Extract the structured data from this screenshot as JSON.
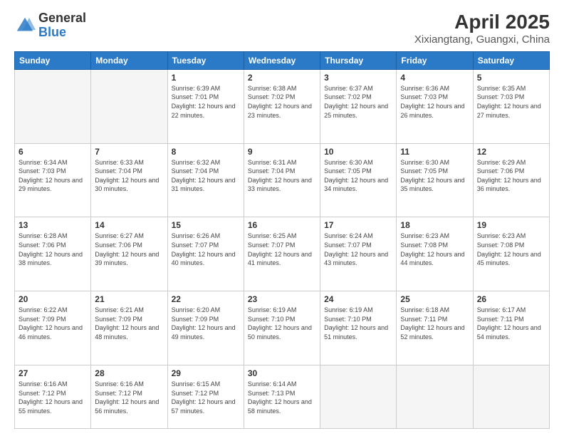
{
  "header": {
    "logo_general": "General",
    "logo_blue": "Blue",
    "title": "April 2025",
    "subtitle": "Xixiangtang, Guangxi, China"
  },
  "days_of_week": [
    "Sunday",
    "Monday",
    "Tuesday",
    "Wednesday",
    "Thursday",
    "Friday",
    "Saturday"
  ],
  "weeks": [
    [
      {
        "day": "",
        "empty": true
      },
      {
        "day": "",
        "empty": true
      },
      {
        "day": "1",
        "sunrise": "6:39 AM",
        "sunset": "7:01 PM",
        "daylight": "12 hours and 22 minutes."
      },
      {
        "day": "2",
        "sunrise": "6:38 AM",
        "sunset": "7:02 PM",
        "daylight": "12 hours and 23 minutes."
      },
      {
        "day": "3",
        "sunrise": "6:37 AM",
        "sunset": "7:02 PM",
        "daylight": "12 hours and 25 minutes."
      },
      {
        "day": "4",
        "sunrise": "6:36 AM",
        "sunset": "7:03 PM",
        "daylight": "12 hours and 26 minutes."
      },
      {
        "day": "5",
        "sunrise": "6:35 AM",
        "sunset": "7:03 PM",
        "daylight": "12 hours and 27 minutes."
      }
    ],
    [
      {
        "day": "6",
        "sunrise": "6:34 AM",
        "sunset": "7:03 PM",
        "daylight": "12 hours and 29 minutes."
      },
      {
        "day": "7",
        "sunrise": "6:33 AM",
        "sunset": "7:04 PM",
        "daylight": "12 hours and 30 minutes."
      },
      {
        "day": "8",
        "sunrise": "6:32 AM",
        "sunset": "7:04 PM",
        "daylight": "12 hours and 31 minutes."
      },
      {
        "day": "9",
        "sunrise": "6:31 AM",
        "sunset": "7:04 PM",
        "daylight": "12 hours and 33 minutes."
      },
      {
        "day": "10",
        "sunrise": "6:30 AM",
        "sunset": "7:05 PM",
        "daylight": "12 hours and 34 minutes."
      },
      {
        "day": "11",
        "sunrise": "6:30 AM",
        "sunset": "7:05 PM",
        "daylight": "12 hours and 35 minutes."
      },
      {
        "day": "12",
        "sunrise": "6:29 AM",
        "sunset": "7:06 PM",
        "daylight": "12 hours and 36 minutes."
      }
    ],
    [
      {
        "day": "13",
        "sunrise": "6:28 AM",
        "sunset": "7:06 PM",
        "daylight": "12 hours and 38 minutes."
      },
      {
        "day": "14",
        "sunrise": "6:27 AM",
        "sunset": "7:06 PM",
        "daylight": "12 hours and 39 minutes."
      },
      {
        "day": "15",
        "sunrise": "6:26 AM",
        "sunset": "7:07 PM",
        "daylight": "12 hours and 40 minutes."
      },
      {
        "day": "16",
        "sunrise": "6:25 AM",
        "sunset": "7:07 PM",
        "daylight": "12 hours and 41 minutes."
      },
      {
        "day": "17",
        "sunrise": "6:24 AM",
        "sunset": "7:07 PM",
        "daylight": "12 hours and 43 minutes."
      },
      {
        "day": "18",
        "sunrise": "6:23 AM",
        "sunset": "7:08 PM",
        "daylight": "12 hours and 44 minutes."
      },
      {
        "day": "19",
        "sunrise": "6:23 AM",
        "sunset": "7:08 PM",
        "daylight": "12 hours and 45 minutes."
      }
    ],
    [
      {
        "day": "20",
        "sunrise": "6:22 AM",
        "sunset": "7:09 PM",
        "daylight": "12 hours and 46 minutes."
      },
      {
        "day": "21",
        "sunrise": "6:21 AM",
        "sunset": "7:09 PM",
        "daylight": "12 hours and 48 minutes."
      },
      {
        "day": "22",
        "sunrise": "6:20 AM",
        "sunset": "7:09 PM",
        "daylight": "12 hours and 49 minutes."
      },
      {
        "day": "23",
        "sunrise": "6:19 AM",
        "sunset": "7:10 PM",
        "daylight": "12 hours and 50 minutes."
      },
      {
        "day": "24",
        "sunrise": "6:19 AM",
        "sunset": "7:10 PM",
        "daylight": "12 hours and 51 minutes."
      },
      {
        "day": "25",
        "sunrise": "6:18 AM",
        "sunset": "7:11 PM",
        "daylight": "12 hours and 52 minutes."
      },
      {
        "day": "26",
        "sunrise": "6:17 AM",
        "sunset": "7:11 PM",
        "daylight": "12 hours and 54 minutes."
      }
    ],
    [
      {
        "day": "27",
        "sunrise": "6:16 AM",
        "sunset": "7:12 PM",
        "daylight": "12 hours and 55 minutes."
      },
      {
        "day": "28",
        "sunrise": "6:16 AM",
        "sunset": "7:12 PM",
        "daylight": "12 hours and 56 minutes."
      },
      {
        "day": "29",
        "sunrise": "6:15 AM",
        "sunset": "7:12 PM",
        "daylight": "12 hours and 57 minutes."
      },
      {
        "day": "30",
        "sunrise": "6:14 AM",
        "sunset": "7:13 PM",
        "daylight": "12 hours and 58 minutes."
      },
      {
        "day": "",
        "empty": true
      },
      {
        "day": "",
        "empty": true
      },
      {
        "day": "",
        "empty": true
      }
    ]
  ]
}
